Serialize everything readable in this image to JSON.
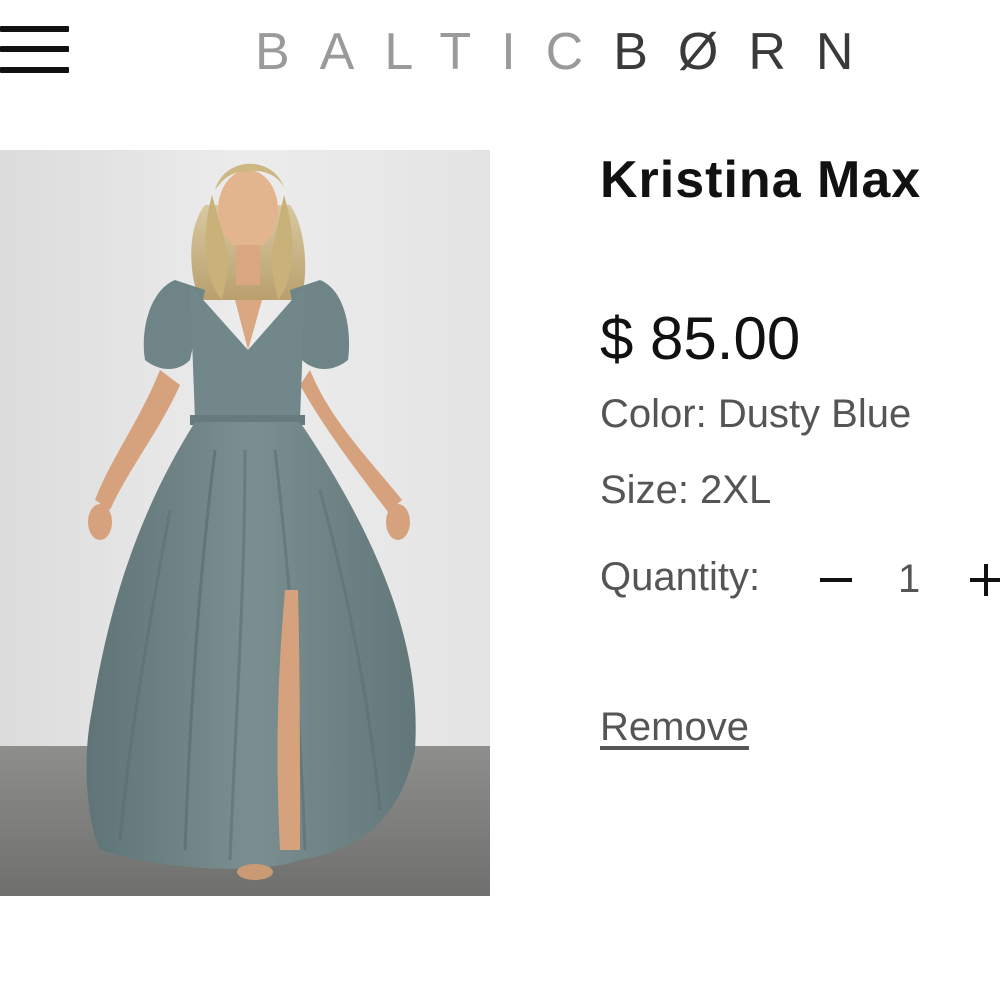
{
  "header": {
    "menu_icon": "hamburger-menu-icon",
    "logo_part1": "BALTIC",
    "logo_part2": "BØRN"
  },
  "product": {
    "image_icon": "product-photo",
    "title": "Kristina Max",
    "price": "$ 85.00",
    "color": "Color: Dusty Blue",
    "size": "Size: 2XL",
    "quantity_label": "Quantity:",
    "quantity": "1",
    "remove_label": "Remove"
  },
  "colors": {
    "logo_light": "#9a9a9a",
    "logo_dark": "#3a3a3a",
    "dress": "#6e8385",
    "text_primary": "#111111",
    "text_secondary": "#555555"
  }
}
